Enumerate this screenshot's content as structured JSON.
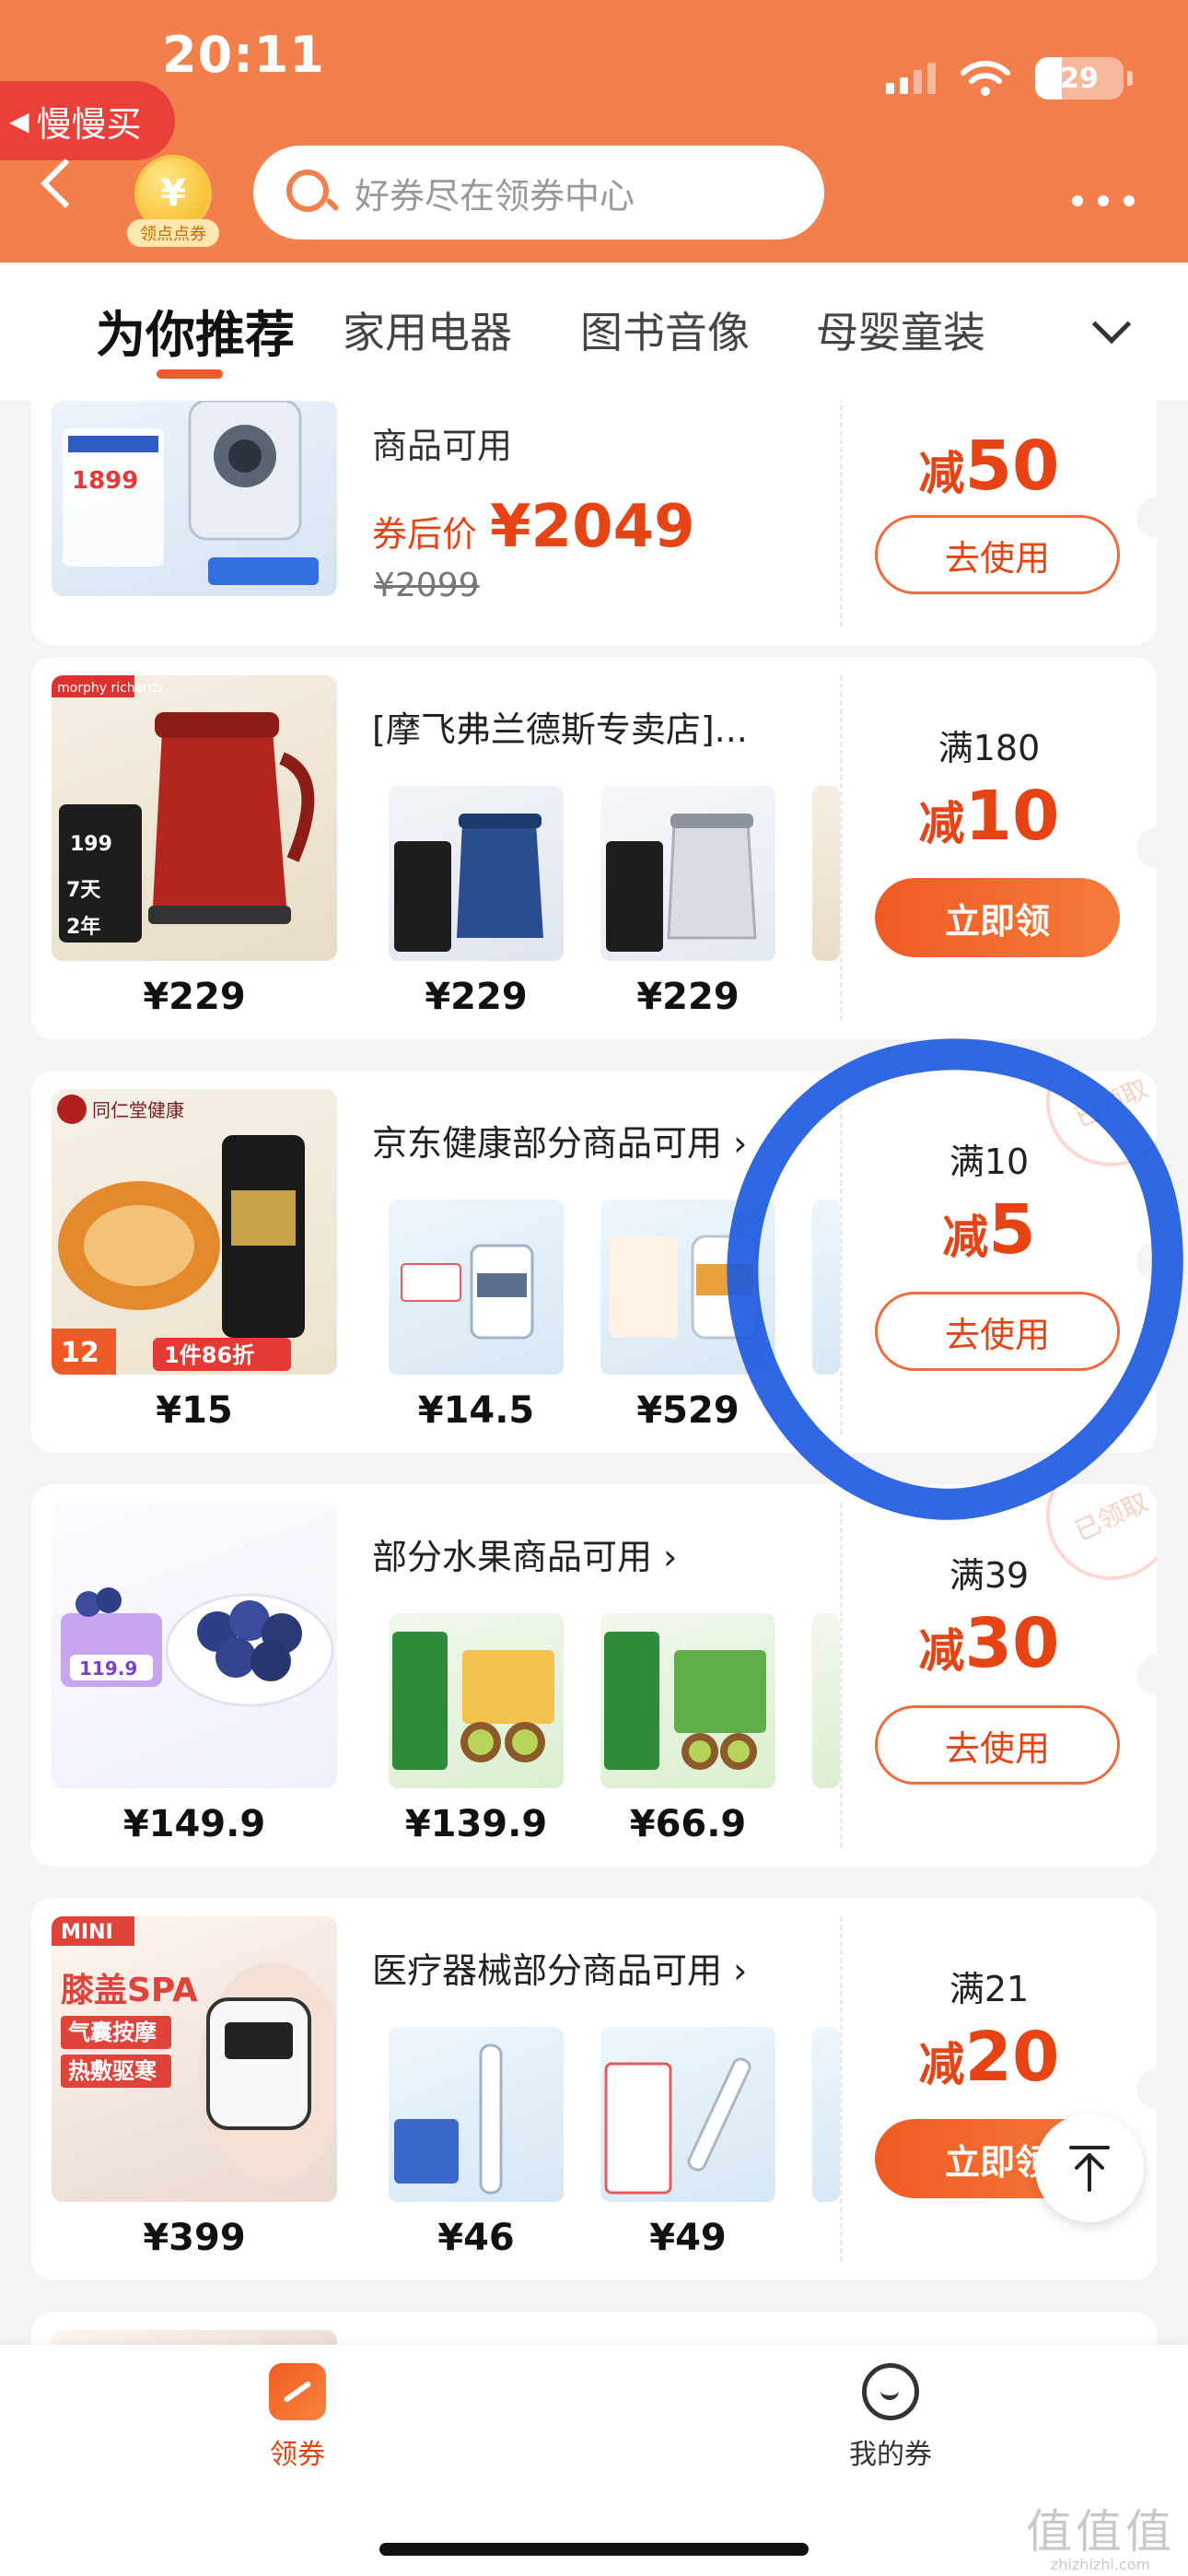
{
  "status_bar": {
    "time": "20:11",
    "battery": "29"
  },
  "header": {
    "back_pill_label": "慢慢买",
    "coin_label": "领点点券",
    "coin_symbol": "¥",
    "search_placeholder": "好券尽在领券中心"
  },
  "tabs": [
    {
      "label": "为你推荐",
      "active": true
    },
    {
      "label": "家用电器",
      "active": false
    },
    {
      "label": "图书音像",
      "active": false
    },
    {
      "label": "母婴童装",
      "active": false
    }
  ],
  "cards": [
    {
      "title": "商品可用",
      "after_coupon_label": "券后价",
      "after_coupon_price": "¥2049",
      "original_price": "¥2099",
      "cut": "50",
      "cut_prefix": "减",
      "button": "去使用"
    },
    {
      "title": "[摩飞弗兰德斯专卖店]...",
      "main_price": "¥229",
      "thumb_prices": [
        "¥229",
        "¥229"
      ],
      "condition": "满180",
      "cut": "10",
      "cut_prefix": "减",
      "button": "立即领"
    },
    {
      "title": "京东健康部分商品可用",
      "title_arrow": "›",
      "main_price": "¥15",
      "thumb_prices": [
        "¥14.5",
        "¥529"
      ],
      "condition": "满10",
      "cut": "5",
      "cut_prefix": "减",
      "button": "去使用",
      "stamp": "已领取"
    },
    {
      "title": "部分水果商品可用",
      "title_arrow": "›",
      "main_price": "¥149.9",
      "thumb_prices": [
        "¥139.9",
        "¥66.9"
      ],
      "condition": "满39",
      "cut": "30",
      "cut_prefix": "减",
      "button": "去使用",
      "stamp": "已领取"
    },
    {
      "title": "医疗器械部分商品可用",
      "title_arrow": "›",
      "main_price": "¥399",
      "thumb_prices": [
        "¥46",
        "¥49"
      ],
      "condition": "满21",
      "cut": "20",
      "cut_prefix": "减",
      "button": "立即领"
    }
  ],
  "image_texts": {
    "kettle_brand": "morphy richards",
    "herb_brand": "同仁堂健康",
    "herb_badge": "1件86折",
    "herb_price": "12",
    "berry_price": "119.9",
    "spa_mini": "MINI",
    "spa_title": "膝盖SPA",
    "spa_line1": "气囊按摩",
    "spa_line2": "热敷驱寒"
  },
  "bottom_nav": [
    {
      "label": "领券",
      "active": true
    },
    {
      "label": "我的券",
      "active": false
    }
  ],
  "watermark": {
    "big": "值值值",
    "small": "zhizhizhi.com"
  },
  "colors": {
    "brand_orange": "#f37f4d",
    "accent_red": "#e64414",
    "annotation_blue": "#1e5ae0"
  }
}
